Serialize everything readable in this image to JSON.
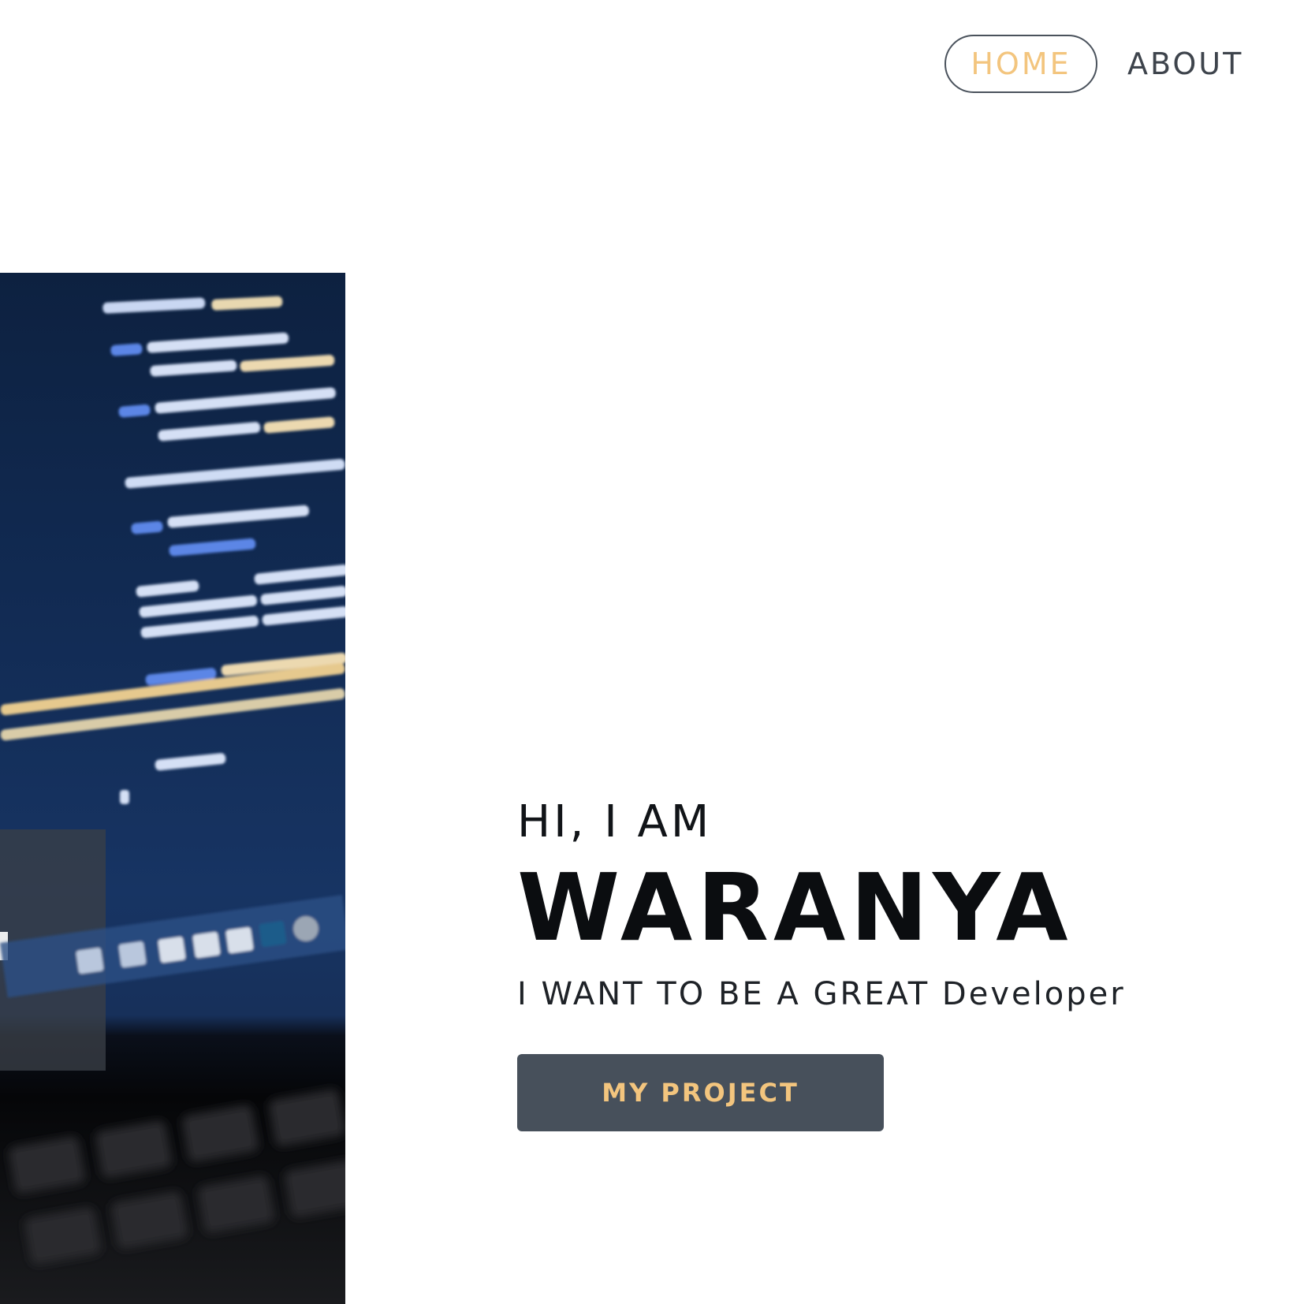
{
  "nav": {
    "home_label": "HOME",
    "about_label": "ABOUT"
  },
  "hero": {
    "greeting": "HI, I AM",
    "name": "WARANYA",
    "tagline": "I WANT TO BE A GREAT Developer",
    "button_label": "MY PROJECT"
  },
  "colors": {
    "accent": "#f3c57e",
    "button_bg": "#47505b",
    "nav_text": "#3e444c",
    "background": "#ffffff"
  }
}
